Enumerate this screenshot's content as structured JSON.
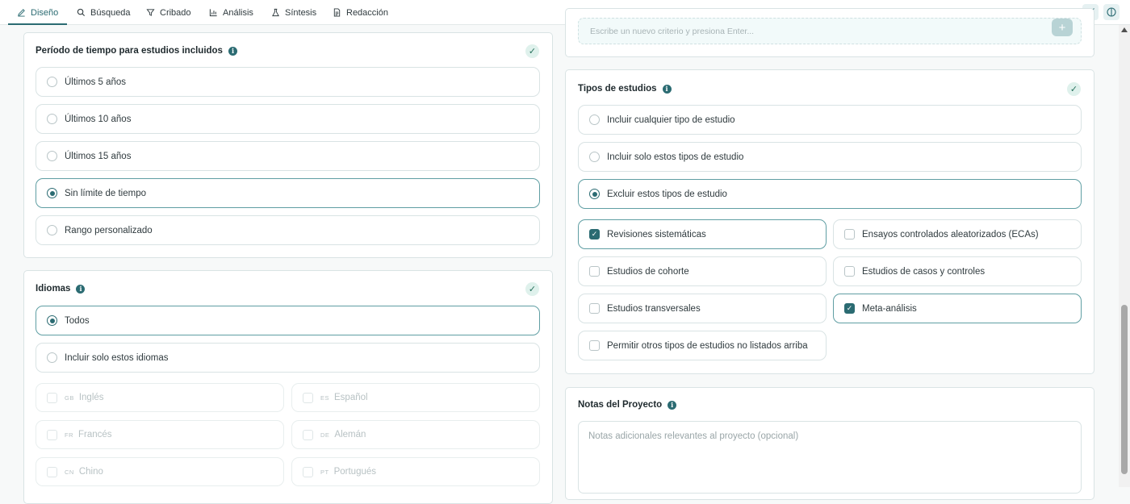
{
  "tabs": [
    {
      "label": "Diseño",
      "icon": "pen-icon"
    },
    {
      "label": "Búsqueda",
      "icon": "search-icon"
    },
    {
      "label": "Cribado",
      "icon": "filter-icon"
    },
    {
      "label": "Análisis",
      "icon": "chart-icon"
    },
    {
      "label": "Síntesis",
      "icon": "flask-icon"
    },
    {
      "label": "Redacción",
      "icon": "document-icon"
    }
  ],
  "active_tab": "Diseño",
  "period": {
    "title": "Período de tiempo para estudios incluidos",
    "options": [
      "Últimos 5 años",
      "Últimos 10 años",
      "Últimos 15 años",
      "Sin límite de tiempo",
      "Rango personalizado"
    ],
    "selected": "Sin límite de tiempo"
  },
  "languages": {
    "title": "Idiomas",
    "options": [
      "Todos",
      "Incluir solo estos idiomas"
    ],
    "selected": "Todos",
    "list": [
      {
        "code": "GB",
        "label": "Inglés"
      },
      {
        "code": "ES",
        "label": "Español"
      },
      {
        "code": "FR",
        "label": "Francés"
      },
      {
        "code": "DE",
        "label": "Alemán"
      },
      {
        "code": "CN",
        "label": "Chino"
      },
      {
        "code": "PT",
        "label": "Portugués"
      }
    ]
  },
  "criteria": {
    "placeholder": "Escribe un nuevo criterio y presiona Enter...",
    "add_label": "+"
  },
  "study_types": {
    "title": "Tipos de estudios",
    "options": [
      "Incluir cualquier tipo de estudio",
      "Incluir solo estos tipos de estudio",
      "Excluir estos tipos de estudio"
    ],
    "selected": "Excluir estos tipos de estudio",
    "list": [
      {
        "label": "Revisiones sistemáticas",
        "checked": true
      },
      {
        "label": "Ensayos controlados aleatorizados (ECAs)",
        "checked": false
      },
      {
        "label": "Estudios de cohorte",
        "checked": false
      },
      {
        "label": "Estudios de casos y controles",
        "checked": false
      },
      {
        "label": "Estudios transversales",
        "checked": false
      },
      {
        "label": "Meta-análisis",
        "checked": true
      },
      {
        "label": "Permitir otros tipos de estudios no listados arriba",
        "checked": false
      }
    ]
  },
  "notes": {
    "title": "Notas del Proyecto",
    "placeholder": "Notas adicionales relevantes al proyecto (opcional)"
  },
  "colors": {
    "accent": "#2b6b72",
    "badge_bg": "#dff1ec",
    "border": "#d9e3e4"
  }
}
